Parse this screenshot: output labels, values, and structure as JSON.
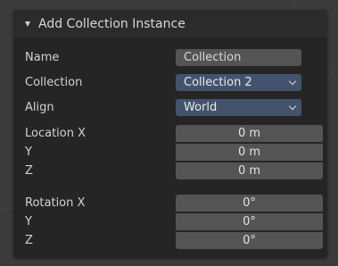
{
  "panel": {
    "title": "Add Collection Instance"
  },
  "fields": {
    "name": {
      "label": "Name",
      "value": "Collection"
    },
    "collection": {
      "label": "Collection",
      "value": "Collection 2"
    },
    "align": {
      "label": "Align",
      "value": "World"
    },
    "location": [
      {
        "label": "Location X",
        "value": "0 m"
      },
      {
        "label": "Y",
        "value": "0 m"
      },
      {
        "label": "Z",
        "value": "0 m"
      }
    ],
    "rotation": [
      {
        "label": "Rotation X",
        "value": "0°"
      },
      {
        "label": "Y",
        "value": "0°"
      },
      {
        "label": "Z",
        "value": "0°"
      }
    ]
  },
  "colors": {
    "panel_bg": "#252525",
    "dropdown_bg": "#44536d",
    "field_bg": "#545454"
  }
}
